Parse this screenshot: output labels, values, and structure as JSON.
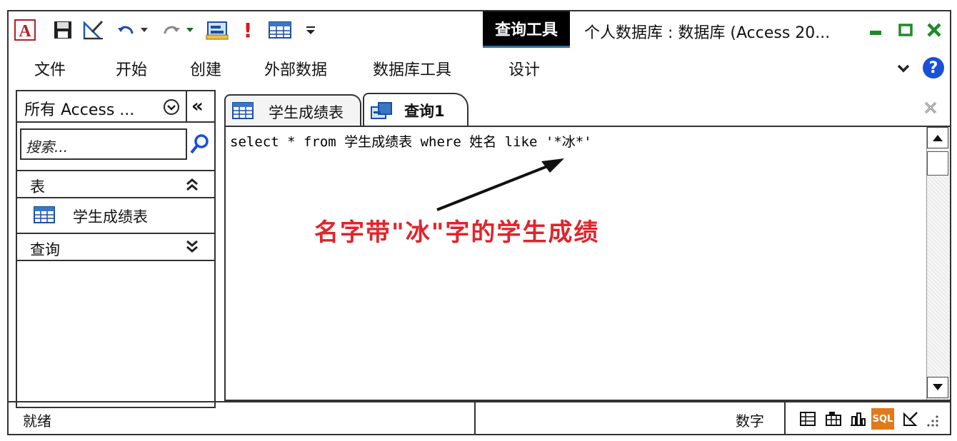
{
  "app": {
    "access_logo": "A",
    "context_tab": "查询工具",
    "title": "个人数据库 : 数据库 (Access 20...",
    "icons": [
      "access-logo-icon",
      "save-icon",
      "design-icon",
      "undo-icon",
      "redo-icon",
      "query-view-icon",
      "run-icon",
      "datasheet-icon",
      "customize-icon"
    ],
    "run_glyph": "!",
    "minimize_glyph": "▬",
    "restore_glyph": "□",
    "close_glyph": "✕"
  },
  "menu": {
    "items": [
      "文件",
      "开始",
      "创建",
      "外部数据",
      "数据库工具",
      "设计"
    ],
    "help_glyph": "?",
    "collapse_glyph": "⌄"
  },
  "nav": {
    "header": "所有 Access ...",
    "collapse_glyph": "«",
    "search_placeholder": "搜索...",
    "groups": [
      {
        "label": "表",
        "chevron": "⌃⌃",
        "items": [
          "学生成绩表"
        ]
      },
      {
        "label": "查询",
        "chevron": "⌄⌄",
        "items": []
      }
    ]
  },
  "tabs": [
    {
      "label": "学生成绩表",
      "active": false
    },
    {
      "label": "查询1",
      "active": true
    }
  ],
  "editor": {
    "sql": "select * from 学生成绩表 where 姓名 like '*冰*'",
    "annotation": "名字带\"冰\"字的学生成绩",
    "annotation_color": "#e0242b"
  },
  "status": {
    "left": "就绪",
    "right": "数字",
    "sql_label": "SQL",
    "view_icons": [
      "datasheet-view-icon",
      "pivot-table-icon",
      "pivot-chart-icon",
      "sql-view-icon",
      "design-view-icon"
    ]
  },
  "colors": {
    "help": "#1a4fd8",
    "winbtn": "#1f8a2a",
    "sql_badge": "#e07a1a"
  }
}
